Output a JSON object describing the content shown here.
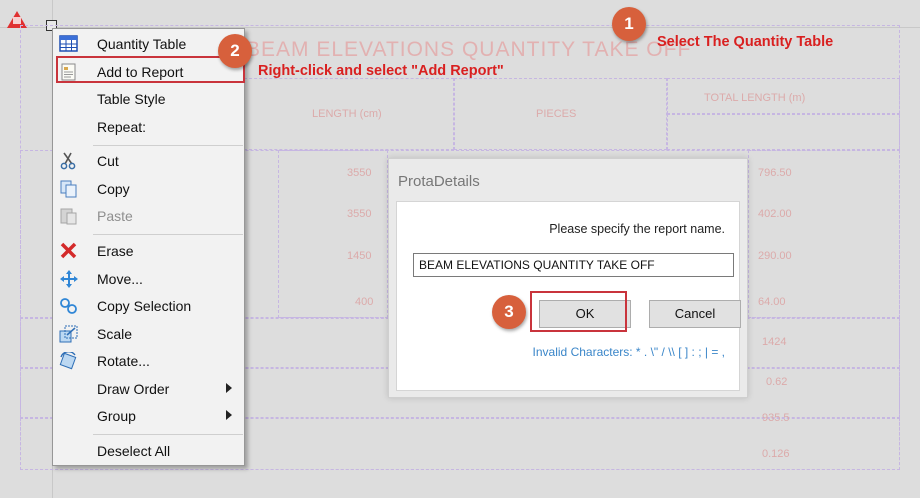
{
  "cad": {
    "table_title": "BEAM ELEVATIONS QUANTITY TAKE OFF",
    "ghost_header_length": "LENGTH (cm)",
    "ghost_header_pieces": "PIECES",
    "ghost_header_total": "TOTAL LENGTH (m)",
    "ghost_values": [
      "3550",
      "3550",
      "1450",
      "400"
    ],
    "ghost_totals": [
      "796.50",
      "402.00",
      "290.00",
      "64.00",
      "1424",
      "0.62",
      "935.5",
      "0.126"
    ]
  },
  "menu": {
    "items": [
      {
        "label": "Quantity Table",
        "icon": "table-icon",
        "disabled": false
      },
      {
        "label": "Add to Report",
        "icon": "report-icon",
        "disabled": false
      },
      {
        "label": "Table Style",
        "icon": "",
        "disabled": false
      },
      {
        "label": "Repeat:",
        "icon": "",
        "disabled": false
      },
      {
        "label": "Cut",
        "icon": "scissors-icon",
        "disabled": false
      },
      {
        "label": "Copy",
        "icon": "copy-icon",
        "disabled": false
      },
      {
        "label": "Paste",
        "icon": "paste-icon",
        "disabled": true
      },
      {
        "label": "Erase",
        "icon": "erase-x-icon",
        "disabled": false
      },
      {
        "label": "Move...",
        "icon": "move-arrows-icon",
        "disabled": false
      },
      {
        "label": "Copy Selection",
        "icon": "copy-selection-icon",
        "disabled": false
      },
      {
        "label": "Scale",
        "icon": "scale-icon",
        "disabled": false
      },
      {
        "label": "Rotate...",
        "icon": "rotate-icon",
        "disabled": false
      },
      {
        "label": "Draw Order",
        "icon": "",
        "disabled": false,
        "submenu": true
      },
      {
        "label": "Group",
        "icon": "",
        "disabled": false,
        "submenu": true
      },
      {
        "label": "Deselect All",
        "icon": "",
        "disabled": false
      }
    ]
  },
  "dialog": {
    "title": "ProtaDetails",
    "prompt": "Please specify the report name.",
    "input_value": "BEAM ELEVATIONS QUANTITY TAKE OFF",
    "ok_label": "OK",
    "cancel_label": "Cancel",
    "invalid_chars": "Invalid Characters: * . \\\" / \\\\ [ ] : ; | = ,"
  },
  "annotations": {
    "step1_num": "1",
    "step1_text": "Select The Quantity Table",
    "step2_num": "2",
    "step2_text": "Right-click and select \"Add Report\"",
    "step3_num": "3",
    "accent_color": "#d7603c",
    "highlight_color": "#c9343c"
  }
}
